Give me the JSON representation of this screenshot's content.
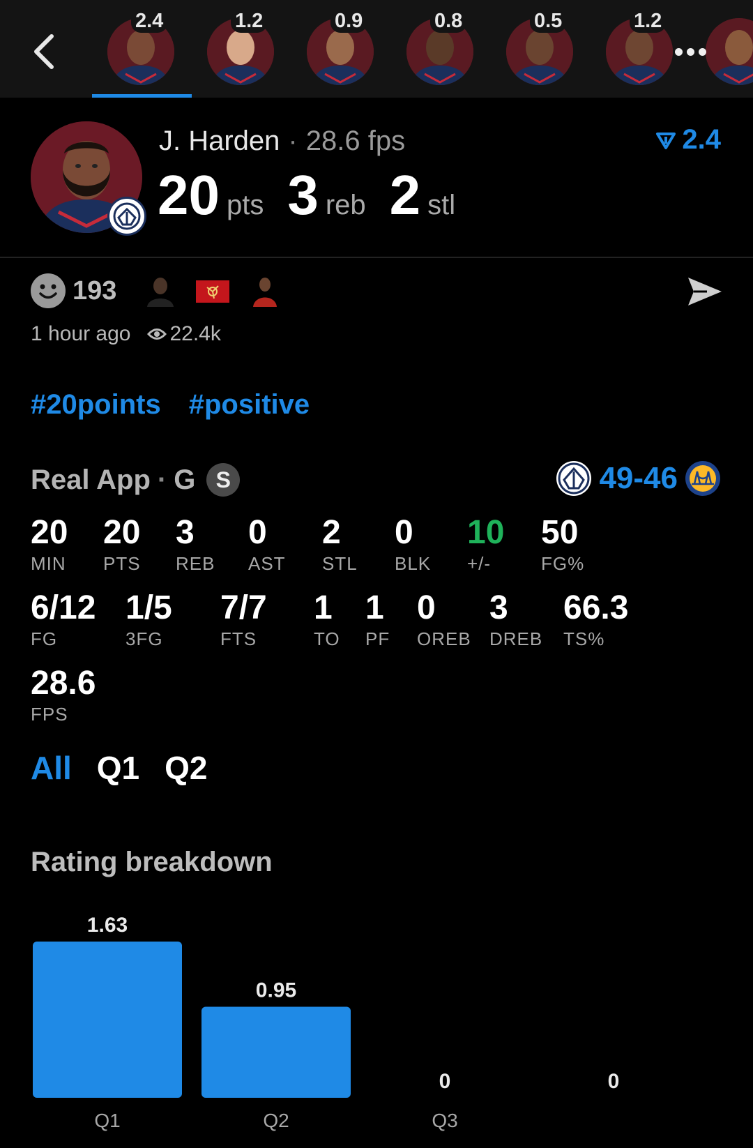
{
  "top_players": [
    {
      "rating": "2.4",
      "active": true,
      "skin": "#7a4a36"
    },
    {
      "rating": "1.2",
      "active": false,
      "skin": "#d8a98a"
    },
    {
      "rating": "0.9",
      "active": false,
      "skin": "#9a6a4c"
    },
    {
      "rating": "0.8",
      "active": false,
      "skin": "#5a3a28"
    },
    {
      "rating": "0.5",
      "active": false,
      "skin": "#6a4430"
    },
    {
      "rating": "1.2",
      "active": false,
      "skin": "#6e4632"
    },
    {
      "rating": "",
      "active": false,
      "skin": "#8a5a3c"
    }
  ],
  "player": {
    "name": "J. Harden",
    "fps": "28.6 fps",
    "rating": "2.4",
    "pts": "20",
    "pts_unit": "pts",
    "reb": "3",
    "reb_unit": "reb",
    "stl": "2",
    "stl_unit": "stl"
  },
  "reactions": {
    "count": "193",
    "time_ago": "1 hour ago",
    "views": "22.4k"
  },
  "hashtags": [
    "#20points",
    "#positive"
  ],
  "game": {
    "source": "Real App",
    "position": "G",
    "badge": "S",
    "score": "49-46"
  },
  "stats_row1": [
    {
      "value": "20",
      "label": "MIN"
    },
    {
      "value": "20",
      "label": "PTS"
    },
    {
      "value": "3",
      "label": "REB"
    },
    {
      "value": "0",
      "label": "AST"
    },
    {
      "value": "2",
      "label": "STL"
    },
    {
      "value": "0",
      "label": "BLK"
    },
    {
      "value": "10",
      "label": "+/-"
    },
    {
      "value": "50",
      "label": "FG%"
    }
  ],
  "stats_row2": [
    {
      "value": "6/12",
      "label": "FG"
    },
    {
      "value": "1/5",
      "label": "3FG"
    },
    {
      "value": "7/7",
      "label": "FTS"
    },
    {
      "value": "1",
      "label": "TO"
    },
    {
      "value": "1",
      "label": "PF"
    },
    {
      "value": "0",
      "label": "OREB"
    },
    {
      "value": "3",
      "label": "DREB"
    },
    {
      "value": "66.3",
      "label": "TS%"
    }
  ],
  "stats_row3": [
    {
      "value": "28.6",
      "label": "FPS"
    }
  ],
  "quarter_tabs": [
    "All",
    "Q1",
    "Q2"
  ],
  "rating_breakdown_title": "Rating breakdown",
  "colors": {
    "accent": "#1f8ae6",
    "positive": "#1fb25a",
    "background": "#000000"
  },
  "chart_data": {
    "type": "bar",
    "categories": [
      "Q1",
      "Q2",
      "Q3",
      ""
    ],
    "values": [
      1.63,
      0.95,
      0,
      0
    ],
    "value_labels": [
      "1.63",
      "0.95",
      "0",
      "0"
    ],
    "title": "Rating breakdown",
    "ylim": [
      0,
      1.63
    ],
    "grid": false,
    "color": "#1f8ae6"
  }
}
